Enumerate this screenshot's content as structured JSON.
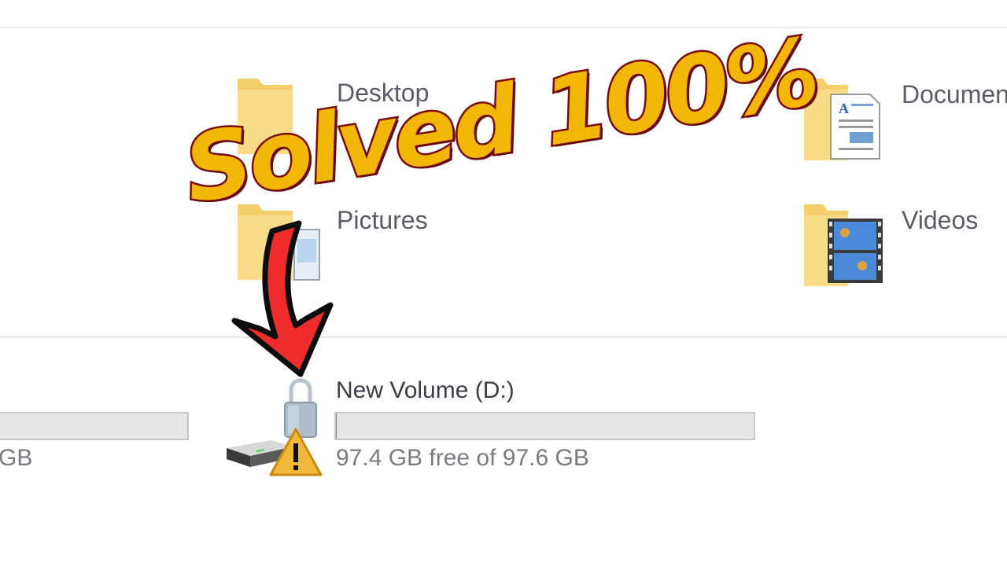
{
  "headline": "Solved 100%",
  "folders": [
    {
      "label": "Desktop"
    },
    {
      "label": "Documents"
    },
    {
      "label": "Pictures"
    },
    {
      "label": "Videos"
    }
  ],
  "drives": [
    {
      "free_text": "GB"
    },
    {
      "label": "New Volume (D:)",
      "free_text": "97.4 GB free of 97.6 GB",
      "used_fraction": 0.002,
      "status": "locked-warning"
    }
  ],
  "colors": {
    "headline_fill": "#f2b705",
    "headline_stroke": "#7a0c0c",
    "arrow": "#ef2b2b",
    "folder": "#f5cf6b"
  },
  "icons": [
    "folder-icon",
    "documents-icon",
    "pictures-icon",
    "videos-icon",
    "drive-icon",
    "lock-icon",
    "warning-icon",
    "arrow-icon"
  ]
}
